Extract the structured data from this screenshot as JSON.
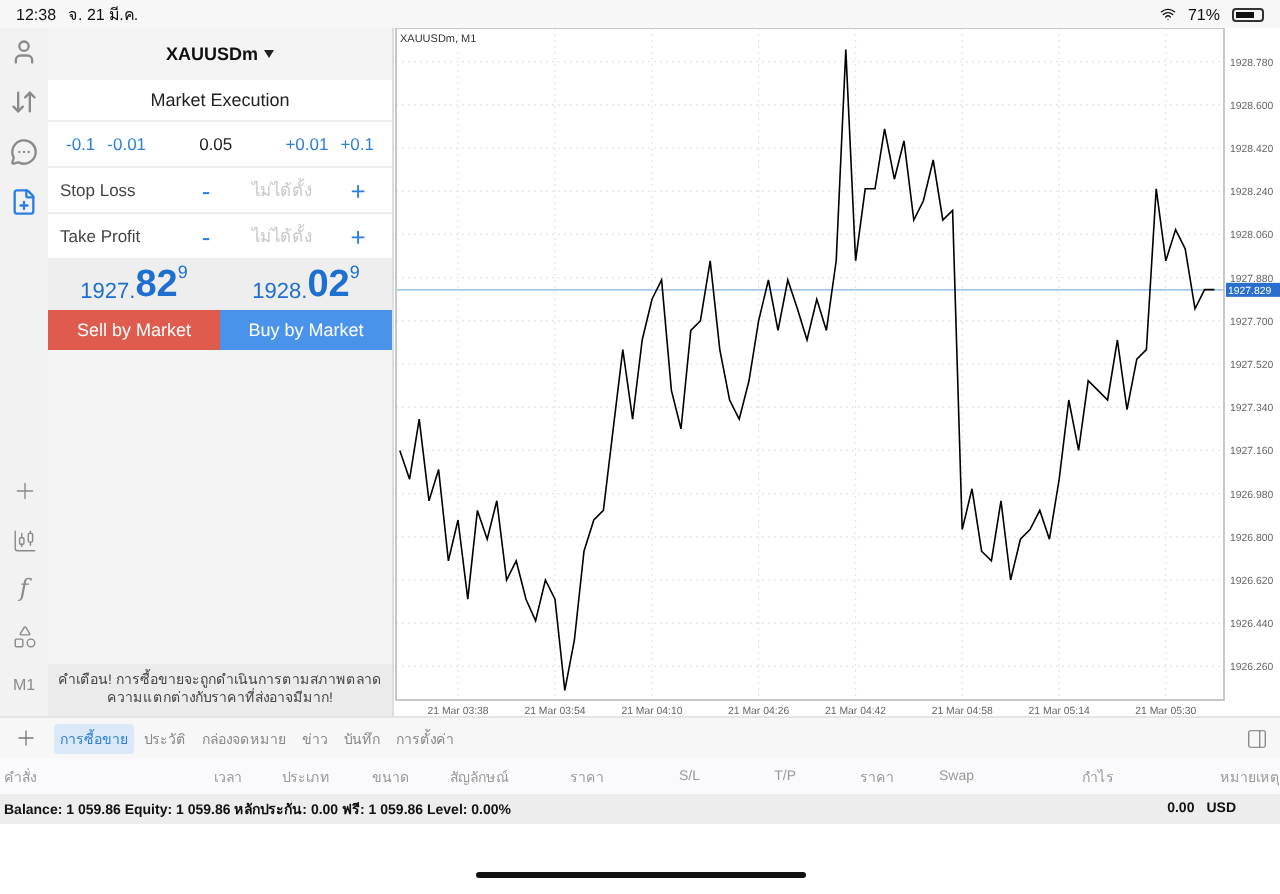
{
  "status_bar": {
    "time": "12:38",
    "date": "จ. 21 มี.ค.",
    "battery": "71%"
  },
  "rail": {
    "items": [
      {
        "selected": false
      },
      {
        "selected": false
      },
      {
        "selected": false
      },
      {
        "selected": true
      }
    ],
    "tools": [
      {
        "kind": "icon"
      },
      {
        "kind": "icon"
      },
      {
        "kind": "glyph",
        "label": "f"
      },
      {
        "kind": "icon"
      },
      {
        "kind": "glyph",
        "label": "M1"
      }
    ]
  },
  "order_panel": {
    "symbol": "XAUUSDm",
    "execution": "Market Execution",
    "volume": {
      "down": [
        "-0.1",
        "-0.01"
      ],
      "value": "0.05",
      "up": [
        "+0.01",
        "+0.1"
      ]
    },
    "stops": [
      {
        "label": "Stop Loss",
        "minus": "-",
        "placeholder": "ไม่ได้ตั้ง",
        "plus": "+"
      },
      {
        "label": "Take Profit",
        "minus": "-",
        "placeholder": "ไม่ได้ตั้ง",
        "plus": "+"
      }
    ],
    "prices": [
      {
        "head": "1927.",
        "big": "82",
        "tail": "9"
      },
      {
        "head": "1928.",
        "big": "02",
        "tail": "9"
      }
    ],
    "actions": [
      {
        "label": "Sell by Market",
        "kind": "sell"
      },
      {
        "label": "Buy by Market",
        "kind": "buy"
      }
    ],
    "warning": [
      "คำเตือน! การซื้อขายจะถูกดำเนินการตามสภาพตลาด",
      "ความแตกต่างกับราคาที่ส่งอาจมีมาก!"
    ]
  },
  "chart": {
    "chart_data": {
      "type": "line",
      "title": "XAUUSDm, M1",
      "grid": true,
      "ref_lines": [
        {
          "axis": "y",
          "value": 1927.829,
          "label": "1927.829",
          "color": "#a9c7e6"
        }
      ],
      "ylim": [
        1926.12,
        1928.92
      ],
      "categories": [
        null,
        null,
        null,
        null,
        null,
        null,
        "21 Mar 03:38",
        null,
        null,
        null,
        null,
        null,
        null,
        null,
        null,
        null,
        "21 Mar 03:54",
        null,
        null,
        null,
        null,
        null,
        null,
        null,
        null,
        null,
        "21 Mar 04:10",
        null,
        null,
        null,
        null,
        null,
        null,
        null,
        null,
        null,
        null,
        "21 Mar 04:26",
        null,
        null,
        null,
        null,
        null,
        null,
        null,
        null,
        null,
        "21 Mar 04:42",
        null,
        null,
        null,
        null,
        null,
        null,
        null,
        null,
        null,
        null,
        "21 Mar 04:58",
        null,
        null,
        null,
        null,
        null,
        null,
        null,
        null,
        null,
        "21 Mar 05:14",
        null,
        null,
        null,
        null,
        null,
        null,
        null,
        null,
        null,
        null,
        "21 Mar 05:30",
        null,
        null,
        null,
        null,
        null
      ],
      "yticks": [
        {
          "value": 1926.26,
          "label": "1926.260"
        },
        {
          "value": 1926.44,
          "label": "1926.440"
        },
        {
          "value": 1926.62,
          "label": "1926.620"
        },
        {
          "value": 1926.8,
          "label": "1926.800"
        },
        {
          "value": 1926.98,
          "label": "1926.980"
        },
        {
          "value": 1927.16,
          "label": "1927.160"
        },
        {
          "value": 1927.34,
          "label": "1927.340"
        },
        {
          "value": 1927.52,
          "label": "1927.520"
        },
        {
          "value": 1927.7,
          "label": "1927.700"
        },
        {
          "value": 1927.88,
          "label": "1927.880"
        },
        {
          "value": 1928.06,
          "label": "1928.060"
        },
        {
          "value": 1928.24,
          "label": "1928.240"
        },
        {
          "value": 1928.42,
          "label": "1928.420"
        },
        {
          "value": 1928.6,
          "label": "1928.600"
        },
        {
          "value": 1928.78,
          "label": "1928.780"
        }
      ],
      "series": [
        {
          "color": "#000000",
          "values": [
            1927.16,
            1927.04,
            1927.29,
            1926.95,
            1927.08,
            1926.7,
            1926.87,
            1926.54,
            1926.91,
            1926.79,
            1926.95,
            1926.62,
            1926.7,
            1926.54,
            1926.45,
            1926.62,
            1926.54,
            1926.16,
            1926.37,
            1926.74,
            1926.87,
            1926.91,
            1927.25,
            1927.58,
            1927.29,
            1927.62,
            1927.79,
            1927.87,
            1927.41,
            1927.25,
            1927.66,
            1927.7,
            1927.95,
            1927.58,
            1927.37,
            1927.29,
            1927.45,
            1927.7,
            1927.87,
            1927.66,
            1927.87,
            1927.75,
            1927.62,
            1927.79,
            1927.66,
            1927.95,
            1928.83,
            1927.95,
            1928.25,
            1928.25,
            1928.5,
            1928.29,
            1928.45,
            1928.12,
            1928.2,
            1928.37,
            1928.12,
            1928.16,
            1926.83,
            1927.0,
            1926.74,
            1926.7,
            1926.95,
            1926.62,
            1926.79,
            1926.83,
            1926.91,
            1926.79,
            1927.04,
            1927.37,
            1927.16,
            1927.45,
            1927.41,
            1927.37,
            1927.62,
            1927.33,
            1927.54,
            1927.58,
            1928.25,
            1927.95,
            1928.08,
            1928.0,
            1927.75,
            1927.83,
            1927.83
          ]
        }
      ]
    }
  },
  "tabs": [
    {
      "label": "การซื้อขาย",
      "selected": true
    },
    {
      "label": "ประวัติ",
      "selected": false
    },
    {
      "label": "กล่องจดหมาย",
      "selected": false
    },
    {
      "label": "ข่าว",
      "selected": false
    },
    {
      "label": "บันทึก",
      "selected": false
    },
    {
      "label": "การตั้งค่า",
      "selected": false
    }
  ],
  "table": {
    "columns": [
      "คำสั่ง",
      "เวลา",
      "ประเภท",
      "ขนาด",
      "สัญลักษณ์",
      "ราคา",
      "S/L",
      "T/P",
      "ราคา",
      "Swap",
      "กำไร",
      "หมายเหตุ"
    ],
    "summary": {
      "text": "Balance: 1 059.86 Equity: 1 059.86 หลักประกัน: 0.00 ฟรี: 1 059.86 Level: 0.00%",
      "profit": "0.00",
      "currency": "USD"
    }
  }
}
